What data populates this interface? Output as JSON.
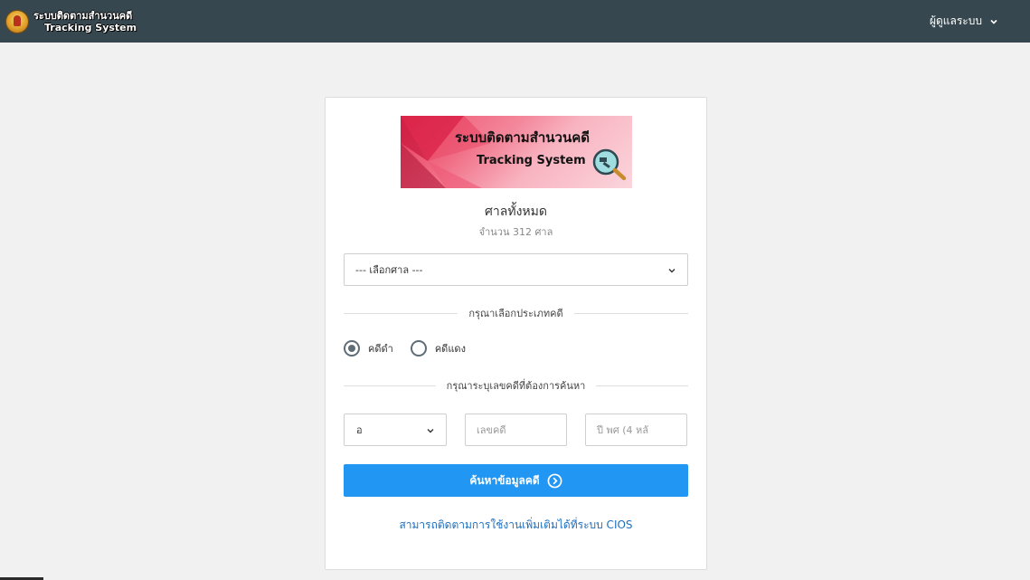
{
  "topbar": {
    "brand_line1": "ระบบติดตามสำนวนคดี",
    "brand_line2": "Tracking System",
    "admin_label": "ผู้ดูแลระบบ"
  },
  "banner": {
    "title": "ระบบติดตามสำนวนคดี",
    "subtitle": "Tracking System"
  },
  "court": {
    "title": "ศาลทั้งหมด",
    "count_text": "จำนวน 312 ศาล",
    "select_value": "--- เลือกศาล ---"
  },
  "case_type": {
    "heading": "กรุณาเลือกประเภทคดี",
    "options": [
      {
        "label": "คดีดำ",
        "checked": true
      },
      {
        "label": "คดีแดง",
        "checked": false
      }
    ]
  },
  "case_number": {
    "heading": "กรุณาระบุเลขคดีที่ต้องการค้นหา",
    "prefix_value": "อ",
    "case_placeholder": "เลขคดี",
    "year_placeholder": "ปี พศ (4 หลั"
  },
  "search_button_label": "ค้นหาข้อมูลคดี",
  "cios_link_text": "สามารถติดตามการใช้งานเพิ่มเติมได้ที่ระบบ CIOS",
  "colors": {
    "topbar": "#37474f",
    "primary_button": "#2196f3",
    "link": "#1e6fbf"
  },
  "icons": [
    "court-seal-icon",
    "chevron-down-icon",
    "magnifier-icon",
    "arrow-circle-right-icon"
  ]
}
